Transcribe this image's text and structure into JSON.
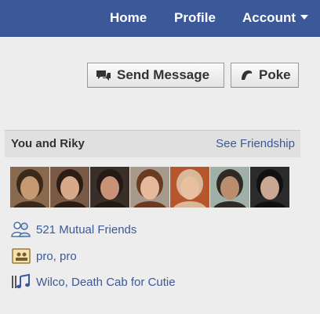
{
  "nav": {
    "home": "Home",
    "profile": "Profile",
    "account": "Account"
  },
  "actions": {
    "send_message": "Send Message",
    "poke": "Poke"
  },
  "friendship": {
    "title": "You and Riky",
    "see_friendship": "See Friendship"
  },
  "photos": [
    {
      "icon": "friend-photo-1",
      "bg": "#8a6a4e",
      "face": "#c59a72",
      "hair": "#3a2a1c"
    },
    {
      "icon": "friend-photo-2",
      "bg": "#7a5a45",
      "face": "#d8a988",
      "hair": "#2a1d16"
    },
    {
      "icon": "friend-photo-3",
      "bg": "#3a2e28",
      "face": "#c99276",
      "hair": "#231915"
    },
    {
      "icon": "friend-photo-4",
      "bg": "#a89a8a",
      "face": "#e6b89c",
      "hair": "#6a3a22"
    },
    {
      "icon": "friend-photo-5",
      "bg": "#b7562c",
      "face": "#e7c0a0",
      "hair": "#d8b89a"
    },
    {
      "icon": "friend-photo-6",
      "bg": "#9fb0a8",
      "face": "#b98d6e",
      "hair": "#2f2a26"
    },
    {
      "icon": "friend-photo-7",
      "bg": "#2b2b2b",
      "face": "#c9a792",
      "hair": "#111111"
    }
  ],
  "info": {
    "mutual_friends": "521 Mutual Friends",
    "work": "pro, pro",
    "music": "Wilco, Death Cab for Cutie"
  },
  "colors": {
    "brand": "#3b5998",
    "link": "#3b5998",
    "background": "#ededed",
    "header_bg": "#e0e0e0"
  }
}
